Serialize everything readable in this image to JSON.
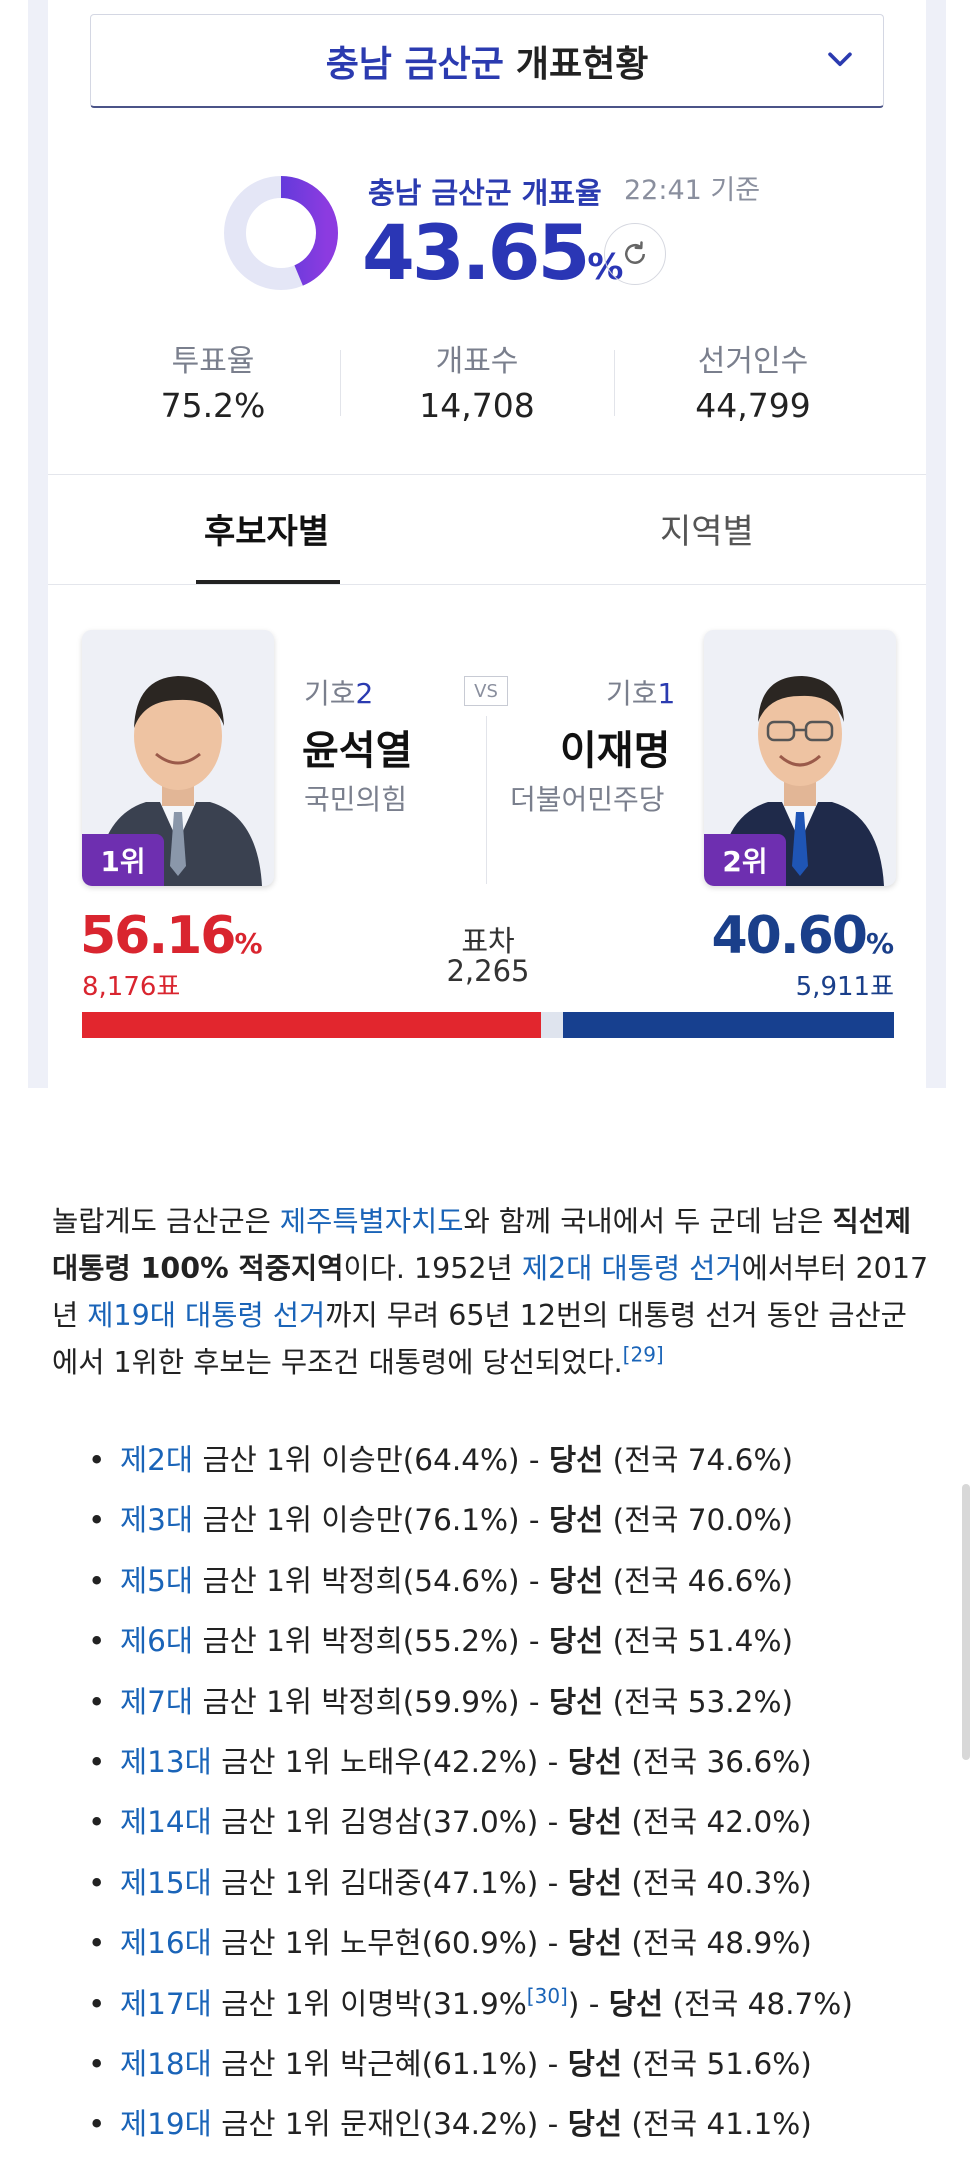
{
  "header": {
    "region": "충남 금산군",
    "title": "개표현황"
  },
  "count_rate": {
    "label": "충남 금산군 개표율",
    "time": "22:41 기준",
    "value": "43.65",
    "unit": "%",
    "progress_percent": 43.65
  },
  "stats": [
    {
      "label": "투표율",
      "value": "75.2%"
    },
    {
      "label": "개표수",
      "value": "14,708"
    },
    {
      "label": "선거인수",
      "value": "44,799"
    }
  ],
  "tabs": [
    {
      "label": "후보자별"
    },
    {
      "label": "지역별"
    }
  ],
  "vs_label": "VS",
  "candidates": [
    {
      "rank": "1위",
      "number_prefix": "기호",
      "number": "2",
      "name": "윤석열",
      "party": "국민의힘",
      "percent": "56.16",
      "votes": "8,176표",
      "share": 56.16,
      "color": "#e2262e"
    },
    {
      "rank": "2위",
      "number_prefix": "기호",
      "number": "1",
      "name": "이재명",
      "party": "더불어민주당",
      "percent": "40.60",
      "votes": "5,911표",
      "share": 40.6,
      "color": "#17408f"
    }
  ],
  "percent_unit": "%",
  "difference": {
    "label": "표차",
    "value": "2,265"
  },
  "article": {
    "p1": "놀랍게도 금산군은 ",
    "link1": "제주특별자치도",
    "p2": "와 함께 국내에서 두 군데 남은 ",
    "bold1": "직선제 대통령 100% 적중지역",
    "p3": "이다. 1952년 ",
    "link2": "제2대 대통령 선거",
    "p4": "에서부터 2017년 ",
    "link3": "제19대 대통령 선거",
    "p5": "까지 무려 65년 12번의 대통령 선거 동안 금산군에서 1위한 후보는 무조건 대통령에 당선되었다.",
    "ref": "[29]"
  },
  "history": [
    {
      "term": "제2대",
      "text": " 금산 1위 이승만(64.4%) - ",
      "result": "당선",
      "national": " (전국 74.6%)"
    },
    {
      "term": "제3대",
      "text": " 금산 1위 이승만(76.1%) - ",
      "result": "당선",
      "national": " (전국 70.0%)"
    },
    {
      "term": "제5대",
      "text": " 금산 1위 박정희(54.6%) - ",
      "result": "당선",
      "national": " (전국 46.6%)"
    },
    {
      "term": "제6대",
      "text": " 금산 1위 박정희(55.2%) - ",
      "result": "당선",
      "national": " (전국 51.4%)"
    },
    {
      "term": "제7대",
      "text": " 금산 1위 박정희(59.9%) - ",
      "result": "당선",
      "national": " (전국 53.2%)"
    },
    {
      "term": "제13대",
      "text": " 금산 1위 노태우(42.2%) - ",
      "result": "당선",
      "national": " (전국 36.6%)"
    },
    {
      "term": "제14대",
      "text": " 금산 1위 김영삼(37.0%) - ",
      "result": "당선",
      "national": " (전국 42.0%)"
    },
    {
      "term": "제15대",
      "text": " 금산 1위 김대중(47.1%) - ",
      "result": "당선",
      "national": " (전국 40.3%)"
    },
    {
      "term": "제16대",
      "text": " 금산 1위 노무현(60.9%) - ",
      "result": "당선",
      "national": " (전국 48.9%)"
    },
    {
      "term": "제17대",
      "text": " 금산 1위 이명박(31.9%",
      "ref": "[30]",
      "text2": ") - ",
      "result": "당선",
      "national": " (전국 48.7%)"
    },
    {
      "term": "제18대",
      "text": " 금산 1위 박근혜(61.1%) - ",
      "result": "당선",
      "national": " (전국 51.6%)"
    },
    {
      "term": "제19대",
      "text": " 금산 1위 문재인(34.2%) - ",
      "result": "당선",
      "national": " (전국 41.1%)"
    }
  ]
}
